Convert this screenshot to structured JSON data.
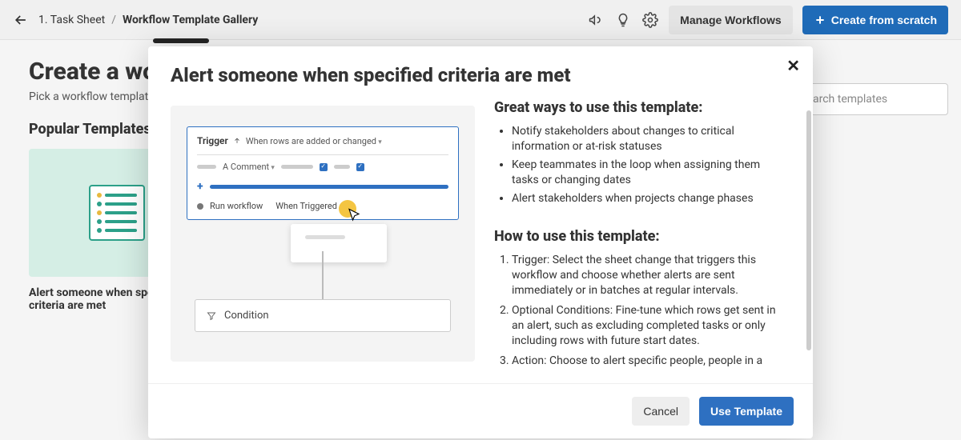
{
  "header": {
    "crumb_prev": "1. Task Sheet",
    "crumb_sep": "/",
    "crumb_current": "Workflow Template Gallery",
    "manage_label": "Manage Workflows",
    "create_label": "Create from scratch"
  },
  "page": {
    "title": "Create a workflow",
    "subtitle": "Pick a workflow template",
    "section_title": "Popular Templates",
    "card1_title": "Alert someone when specified criteria are met",
    "search_placeholder": "arch templates"
  },
  "modal": {
    "title": "Alert someone when specified criteria are met",
    "great_heading": "Great ways to use this template:",
    "bullets": [
      "Notify stakeholders about changes to critical information or at-risk statuses",
      "Keep teammates in the loop when assigning them tasks or changing dates",
      "Alert stakeholders when projects change phases"
    ],
    "how_heading": "How to use this template:",
    "steps": [
      "Trigger: Select the sheet change that triggers this workflow and choose whether alerts are sent immediately or in batches at regular intervals.",
      "Optional Conditions: Fine-tune which rows get sent in an alert, such as excluding completed tasks or only including rows with future start dates.",
      "Action: Choose to alert specific people, people in a"
    ],
    "cancel_label": "Cancel",
    "use_label": "Use Template",
    "preview": {
      "trigger_label": "Trigger",
      "trigger_value": "When rows are added or changed",
      "comment_label": "A Comment",
      "run_label": "Run workflow",
      "when_label": "When Triggered",
      "condition_label": "Condition"
    }
  }
}
